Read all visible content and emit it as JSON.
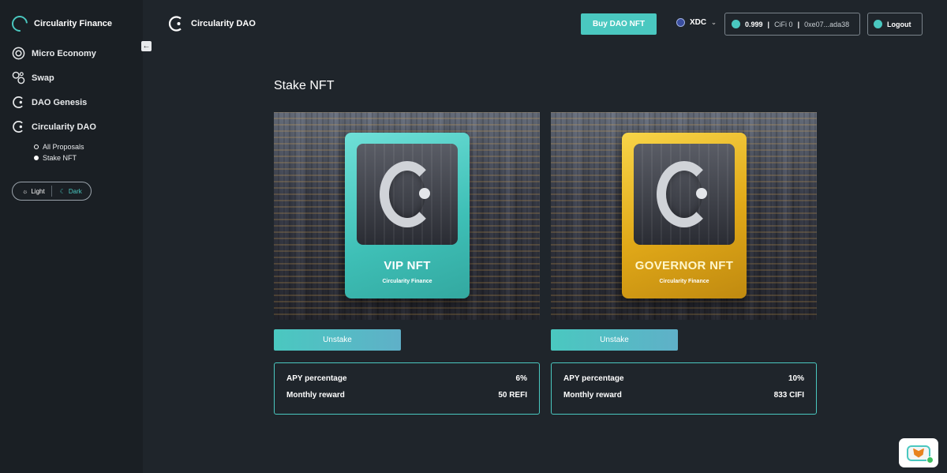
{
  "sidebar": {
    "brand": "Circularity Finance",
    "items": [
      {
        "label": "Micro Economy"
      },
      {
        "label": "Swap"
      },
      {
        "label": "DAO Genesis"
      },
      {
        "label": "Circularity DAO"
      }
    ],
    "subitems": [
      {
        "label": "All Proposals",
        "active": false
      },
      {
        "label": "Stake NFT",
        "active": true
      }
    ],
    "theme": {
      "light": "Light",
      "dark": "Dark",
      "selected": "dark"
    }
  },
  "header": {
    "brand": "Circularity DAO",
    "buy_label": "Buy DAO NFT",
    "network": "XDC",
    "wallet": {
      "balance": "0.999",
      "cifi": "CiFi 0",
      "address": "0xe07...ada38"
    },
    "logout_label": "Logout"
  },
  "main": {
    "title": "Stake NFT",
    "cards": [
      {
        "nft_title": "VIP NFT",
        "nft_subtitle": "Circularity Finance",
        "button_label": "Unstake",
        "apy_label": "APY percentage",
        "apy_value": "6%",
        "reward_label": "Monthly reward",
        "reward_value": "50 REFI"
      },
      {
        "nft_title": "GOVERNOR NFT",
        "nft_subtitle": "Circularity Finance",
        "button_label": "Unstake",
        "apy_label": "APY percentage",
        "apy_value": "10%",
        "reward_label": "Monthly reward",
        "reward_value": "833 CIFI"
      }
    ]
  },
  "colors": {
    "accent": "#4ac8c0",
    "background": "#1f252b",
    "sidebar": "#1a1f24",
    "gold": "#e0a818"
  }
}
